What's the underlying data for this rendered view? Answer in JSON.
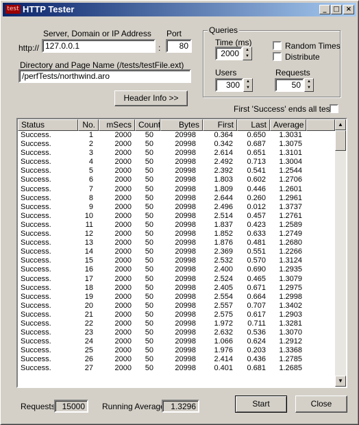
{
  "window": {
    "title": "HTTP Tester",
    "icon_text": "test"
  },
  "server": {
    "label": "Server, Domain or IP Address",
    "prefix": "http://",
    "value": "127.0.0.1",
    "colon": ":",
    "port_label": "Port",
    "port_value": "80"
  },
  "directory": {
    "label": "Directory and Page Name  (/tests/testFile.ext)",
    "value": "/perfTests/northwind.aro"
  },
  "header_button": "Header Info >>",
  "queries": {
    "title": "Queries",
    "time_label": "Time  (ms)",
    "time_value": "2000",
    "users_label": "Users",
    "users_value": "300",
    "requests_label": "Requests",
    "requests_value": "50",
    "random_times": "Random Times",
    "distribute": "Distribute"
  },
  "first_success_label": "First 'Success' ends all tests",
  "table": {
    "columns": [
      "Status",
      "No.",
      "mSecs",
      "Count",
      "Bytes",
      "First",
      "Last",
      "Average"
    ],
    "rows": [
      [
        "Success.",
        "1",
        "2000",
        "50",
        "20998",
        "0.364",
        "0.650",
        "1.3031"
      ],
      [
        "Success.",
        "2",
        "2000",
        "50",
        "20998",
        "0.342",
        "0.687",
        "1.3075"
      ],
      [
        "Success.",
        "3",
        "2000",
        "50",
        "20998",
        "2.614",
        "0.651",
        "1.3101"
      ],
      [
        "Success.",
        "4",
        "2000",
        "50",
        "20998",
        "2.492",
        "0.713",
        "1.3004"
      ],
      [
        "Success.",
        "5",
        "2000",
        "50",
        "20998",
        "2.392",
        "0.541",
        "1.2544"
      ],
      [
        "Success.",
        "6",
        "2000",
        "50",
        "20998",
        "1.803",
        "0.602",
        "1.2706"
      ],
      [
        "Success.",
        "7",
        "2000",
        "50",
        "20998",
        "1.809",
        "0.446",
        "1.2601"
      ],
      [
        "Success.",
        "8",
        "2000",
        "50",
        "20998",
        "2.644",
        "0.260",
        "1.2961"
      ],
      [
        "Success.",
        "9",
        "2000",
        "50",
        "20998",
        "2.496",
        "0.012",
        "1.3737"
      ],
      [
        "Success.",
        "10",
        "2000",
        "50",
        "20998",
        "2.514",
        "0.457",
        "1.2761"
      ],
      [
        "Success.",
        "11",
        "2000",
        "50",
        "20998",
        "1.837",
        "0.423",
        "1.2589"
      ],
      [
        "Success.",
        "12",
        "2000",
        "50",
        "20998",
        "1.852",
        "0.633",
        "1.2749"
      ],
      [
        "Success.",
        "13",
        "2000",
        "50",
        "20998",
        "1.876",
        "0.481",
        "1.2680"
      ],
      [
        "Success.",
        "14",
        "2000",
        "50",
        "20998",
        "2.369",
        "0.551",
        "1.2266"
      ],
      [
        "Success.",
        "15",
        "2000",
        "50",
        "20998",
        "2.532",
        "0.570",
        "1.3124"
      ],
      [
        "Success.",
        "16",
        "2000",
        "50",
        "20998",
        "2.400",
        "0.690",
        "1.2935"
      ],
      [
        "Success.",
        "17",
        "2000",
        "50",
        "20998",
        "2.524",
        "0.465",
        "1.3079"
      ],
      [
        "Success.",
        "18",
        "2000",
        "50",
        "20998",
        "2.405",
        "0.671",
        "1.2975"
      ],
      [
        "Success.",
        "19",
        "2000",
        "50",
        "20998",
        "2.554",
        "0.664",
        "1.2998"
      ],
      [
        "Success.",
        "20",
        "2000",
        "50",
        "20998",
        "2.557",
        "0.707",
        "1.3402"
      ],
      [
        "Success.",
        "21",
        "2000",
        "50",
        "20998",
        "2.575",
        "0.617",
        "1.2903"
      ],
      [
        "Success.",
        "22",
        "2000",
        "50",
        "20998",
        "1.972",
        "0.711",
        "1.3281"
      ],
      [
        "Success.",
        "23",
        "2000",
        "50",
        "20998",
        "2.632",
        "0.536",
        "1.3070"
      ],
      [
        "Success.",
        "24",
        "2000",
        "50",
        "20998",
        "1.066",
        "0.624",
        "1.2912"
      ],
      [
        "Success.",
        "25",
        "2000",
        "50",
        "20998",
        "1.976",
        "0.203",
        "1.3368"
      ],
      [
        "Success.",
        "26",
        "2000",
        "50",
        "20998",
        "2.414",
        "0.436",
        "1.2785"
      ],
      [
        "Success.",
        "27",
        "2000",
        "50",
        "20998",
        "0.401",
        "0.681",
        "1.2685"
      ]
    ]
  },
  "footer": {
    "requests_label": "Requests",
    "requests_value": "15000",
    "running_avg_label": "Running Average",
    "running_avg_value": "1.3296",
    "start_button": "Start",
    "close_button": "Close"
  }
}
